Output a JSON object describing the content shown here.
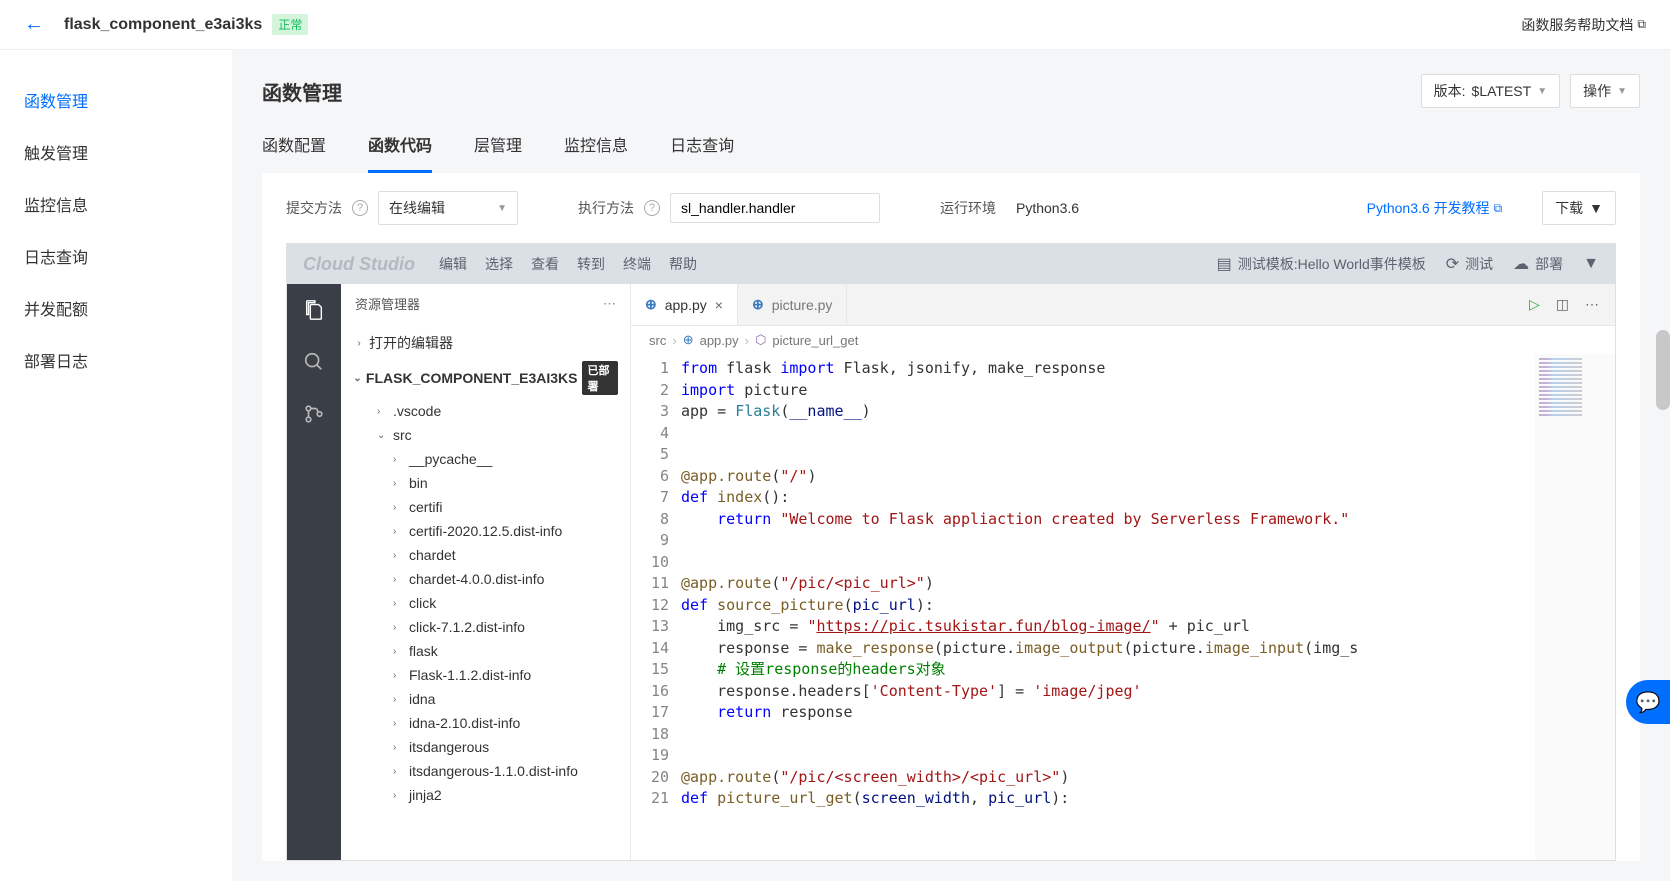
{
  "header": {
    "function_name": "flask_component_e3ai3ks",
    "status": "正常",
    "help_link": "函数服务帮助文档"
  },
  "sidebar": {
    "items": [
      {
        "label": "函数管理",
        "active": true
      },
      {
        "label": "触发管理",
        "active": false
      },
      {
        "label": "监控信息",
        "active": false
      },
      {
        "label": "日志查询",
        "active": false
      },
      {
        "label": "并发配额",
        "active": false
      },
      {
        "label": "部署日志",
        "active": false
      }
    ]
  },
  "content": {
    "title": "函数管理",
    "version_label": "版本:",
    "version_value": "$LATEST",
    "action_label": "操作",
    "tabs": [
      {
        "label": "函数配置",
        "active": false
      },
      {
        "label": "函数代码",
        "active": true
      },
      {
        "label": "层管理",
        "active": false
      },
      {
        "label": "监控信息",
        "active": false
      },
      {
        "label": "日志查询",
        "active": false
      }
    ]
  },
  "toolbar": {
    "submit_label": "提交方法",
    "submit_value": "在线编辑",
    "exec_label": "执行方法",
    "exec_value": "sl_handler.handler",
    "runtime_label": "运行环境",
    "runtime_value": "Python3.6",
    "tutorial_link": "Python3.6 开发教程",
    "download_label": "下载"
  },
  "ide": {
    "brand": "Cloud Studio",
    "menu": [
      "编辑",
      "选择",
      "查看",
      "转到",
      "终端",
      "帮助"
    ],
    "test_template_label": "测试模板:Hello World事件模板",
    "test_label": "测试",
    "deploy_label": "部署",
    "explorer_title": "资源管理器",
    "open_editors": "打开的编辑器",
    "project_name": "FLASK_COMPONENT_E3AI3KS",
    "deployed_badge": "已部署",
    "tree": {
      "vscode": ".vscode",
      "src": "src",
      "children": [
        "__pycache__",
        "bin",
        "certifi",
        "certifi-2020.12.5.dist-info",
        "chardet",
        "chardet-4.0.0.dist-info",
        "click",
        "click-7.1.2.dist-info",
        "flask",
        "Flask-1.1.2.dist-info",
        "idna",
        "idna-2.10.dist-info",
        "itsdangerous",
        "itsdangerous-1.1.0.dist-info",
        "jinja2"
      ]
    },
    "tabs": [
      {
        "name": "app.py",
        "active": true
      },
      {
        "name": "picture.py",
        "active": false
      }
    ],
    "breadcrumb": {
      "src": "src",
      "file": "app.py",
      "symbol": "picture_url_get"
    },
    "code_lines": 21
  }
}
